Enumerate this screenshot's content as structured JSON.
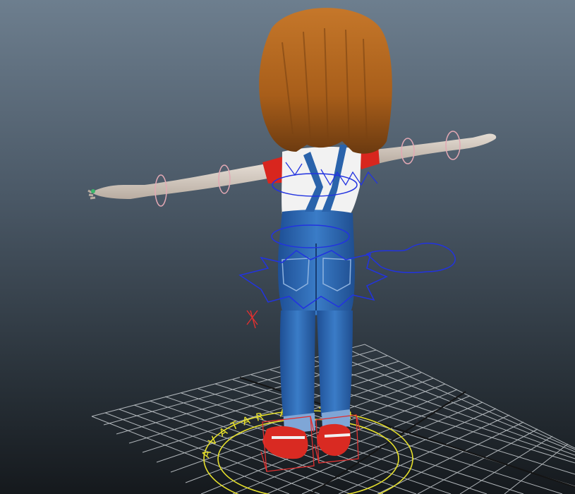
{
  "viewport": {
    "background_top": "#6d7e8e",
    "background_bottom": "#15191d"
  },
  "grid": {
    "line_color": "#c9ced2",
    "axis_color": "#1a1a1a"
  },
  "root_control": {
    "color": "#e6e02c",
    "ring_text": "AVATAR AVATAR"
  },
  "character": {
    "hair_color": "#b96a1e",
    "shirt_color": "#f2f2f2",
    "sleeve_color": "#d8261e",
    "overalls_color": "#2e6db5",
    "skin_color": "#d8cfc6",
    "shoe_color": "#d92a22"
  },
  "rig_controls": {
    "fk_color": "#e3a8b4",
    "ik_color": "#2233e0",
    "foot_color": "#e03030"
  }
}
